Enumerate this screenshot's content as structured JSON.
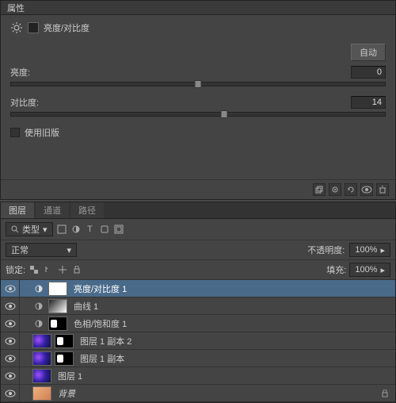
{
  "properties": {
    "panel_title": "属性",
    "adjustment_title": "亮度/对比度",
    "auto_label": "自动",
    "brightness_label": "亮度:",
    "brightness_value": "0",
    "contrast_label": "对比度:",
    "contrast_value": "14",
    "legacy_label": "使用旧版"
  },
  "layers": {
    "tabs": {
      "layers": "图层",
      "channels": "通道",
      "paths": "路径"
    },
    "kind_label": "类型",
    "blend_mode": "正常",
    "opacity_label": "不透明度:",
    "opacity_value": "100%",
    "lock_label": "锁定:",
    "fill_label": "填充:",
    "fill_value": "100%",
    "items": [
      {
        "name": "亮度/对比度 1"
      },
      {
        "name": "曲线 1"
      },
      {
        "name": "色相/饱和度 1"
      },
      {
        "name": "图层 1 副本 2"
      },
      {
        "name": "图层 1 副本"
      },
      {
        "name": "图层 1"
      },
      {
        "name": "背景"
      }
    ]
  }
}
